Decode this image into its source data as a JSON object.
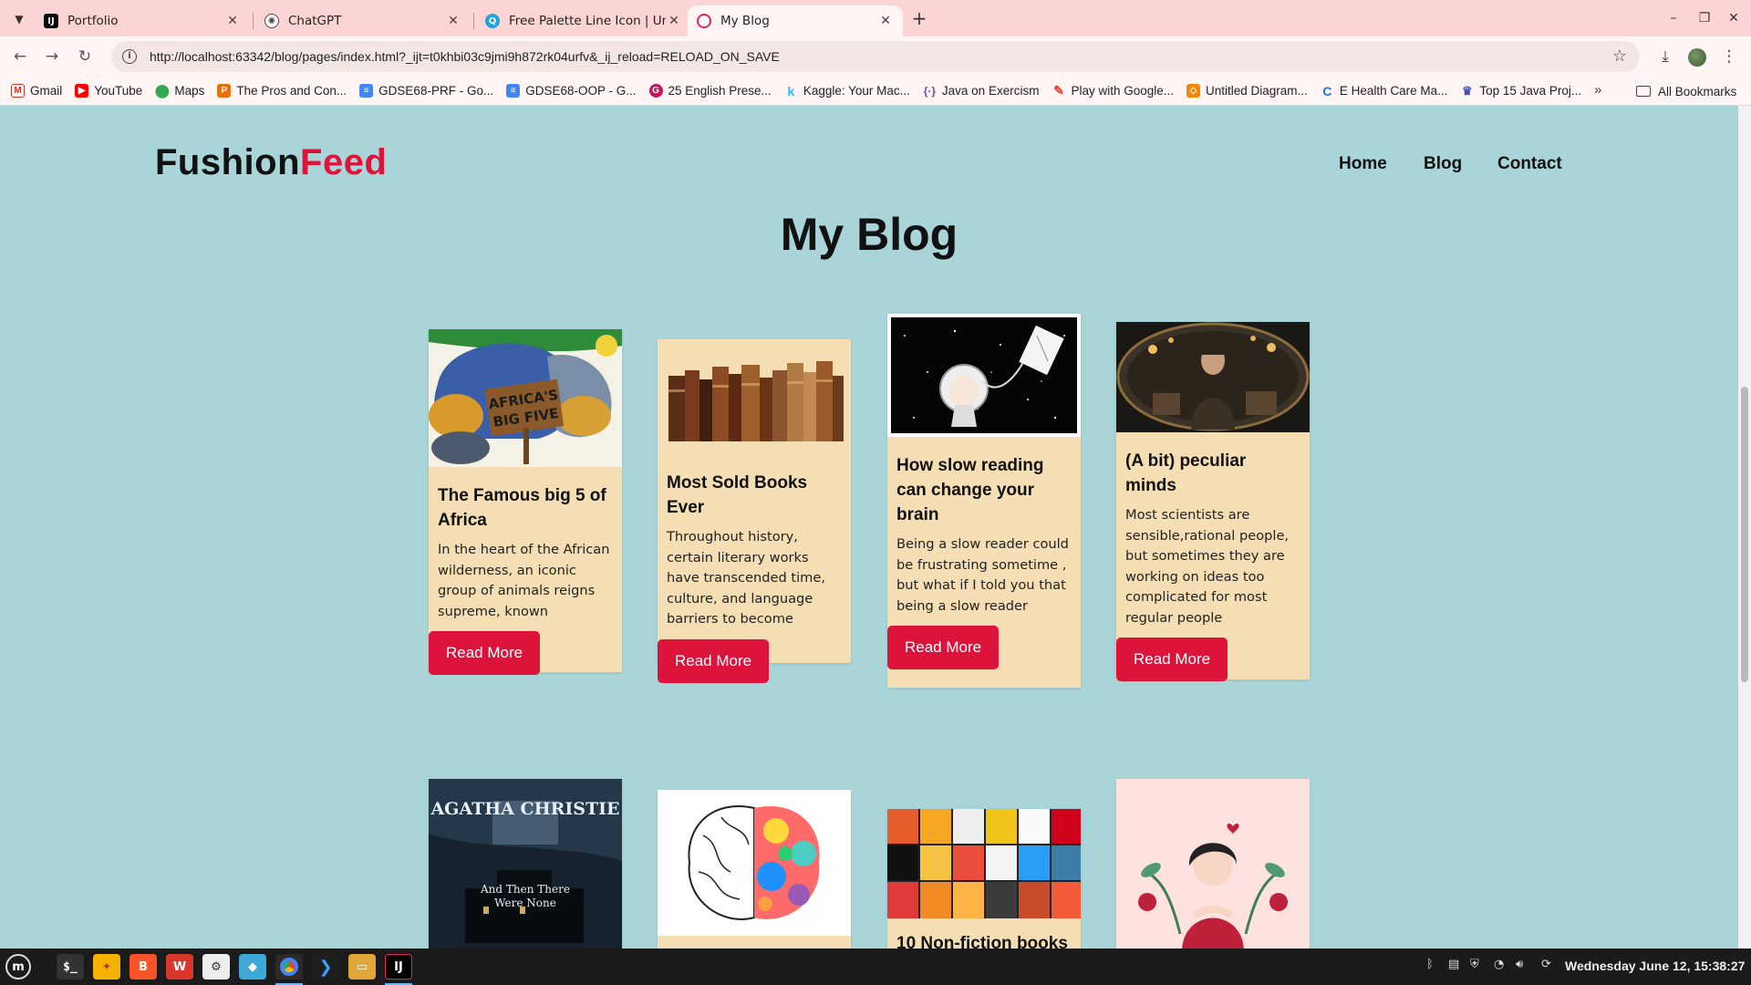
{
  "browser": {
    "tabs": [
      {
        "title": "Portfolio",
        "favicon": "intellij-icon",
        "active": false
      },
      {
        "title": "ChatGPT",
        "favicon": "chatgpt-icon",
        "active": false
      },
      {
        "title": "Free Palette Line Icon | Unic",
        "favicon": "uicons-icon",
        "active": false
      },
      {
        "title": "My Blog",
        "favicon": "blog-icon",
        "active": true
      }
    ],
    "url": "http://localhost:63342/blog/pages/index.html?_ijt=t0khbi03c9jmi9h872rk04urfv&_ij_reload=RELOAD_ON_SAVE",
    "bookmarks": [
      {
        "label": "Gmail",
        "icon": "gmail-icon",
        "color": "#d93025"
      },
      {
        "label": "YouTube",
        "icon": "youtube-icon",
        "color": "#ff0000"
      },
      {
        "label": "Maps",
        "icon": "maps-icon",
        "color": "#34a853"
      },
      {
        "label": "The Pros and Con...",
        "icon": "pros-icon",
        "color": "#e8710a"
      },
      {
        "label": "GDSE68-PRF - Go...",
        "icon": "docs-icon",
        "color": "#4285f4"
      },
      {
        "label": "GDSE68-OOP - G...",
        "icon": "docs-icon",
        "color": "#4285f4"
      },
      {
        "label": "25 English Prese...",
        "icon": "site-icon",
        "color": "#c2185b"
      },
      {
        "label": "Kaggle: Your Mac...",
        "icon": "kaggle-icon",
        "color": "#20beff"
      },
      {
        "label": "Java on Exercism",
        "icon": "exercism-icon",
        "color": "#604fcd"
      },
      {
        "label": "Play with Google...",
        "icon": "google-icon",
        "color": "#ea4335"
      },
      {
        "label": "Untitled Diagram...",
        "icon": "drawio-icon",
        "color": "#f08705"
      },
      {
        "label": "E Health Care Ma...",
        "icon": "site-icon",
        "color": "#1a73e8"
      },
      {
        "label": "Top 15 Java Proj...",
        "icon": "site-icon",
        "color": "#3f51b5"
      }
    ],
    "all_bookmarks": "All Bookmarks"
  },
  "site": {
    "logo_main": "Fushion",
    "logo_accent": "Feed",
    "nav": [
      "Home",
      "Blog",
      "Contact"
    ],
    "page_title": "My Blog",
    "accent_color": "#dc143c",
    "card_color": "#f5deb3",
    "background": "#a9d5d9"
  },
  "posts": [
    {
      "title": "The Famous big 5 of Africa",
      "excerpt": "In the heart of the African wilderness, an iconic group of animals reigns supreme, known",
      "button": "Read More",
      "image": "africa-big-five-illustration"
    },
    {
      "title": "Most Sold Books Ever",
      "excerpt": "Throughout history, certain literary works have transcended time, culture, and language barriers to become",
      "button": "Read More",
      "image": "old-books-row"
    },
    {
      "title": "How slow reading can change your brain",
      "excerpt": "Being a slow reader could be frustrating sometime , but what if I told you that being a slow reader",
      "button": "Read More",
      "image": "astronaut-book-space"
    },
    {
      "title": "(A bit) peculiar minds",
      "excerpt": "Most scientists are sensible,rational people, but sometimes they are working on ideas too complicated for most regular people",
      "button": "Read More",
      "image": "scientist-lab-portrait"
    }
  ],
  "posts_row2": [
    {
      "image": "agatha-christie-cover",
      "cover_author": "AGATHA CHRISTIE",
      "cover_title": "And Then There Were None"
    },
    {
      "image": "colorful-brain"
    },
    {
      "image": "book-covers-grid",
      "title_partial": "10 Non-fiction books"
    },
    {
      "image": "girl-with-flowers"
    }
  ],
  "taskbar": {
    "clock": "Wednesday June 12, 15:38:27"
  }
}
